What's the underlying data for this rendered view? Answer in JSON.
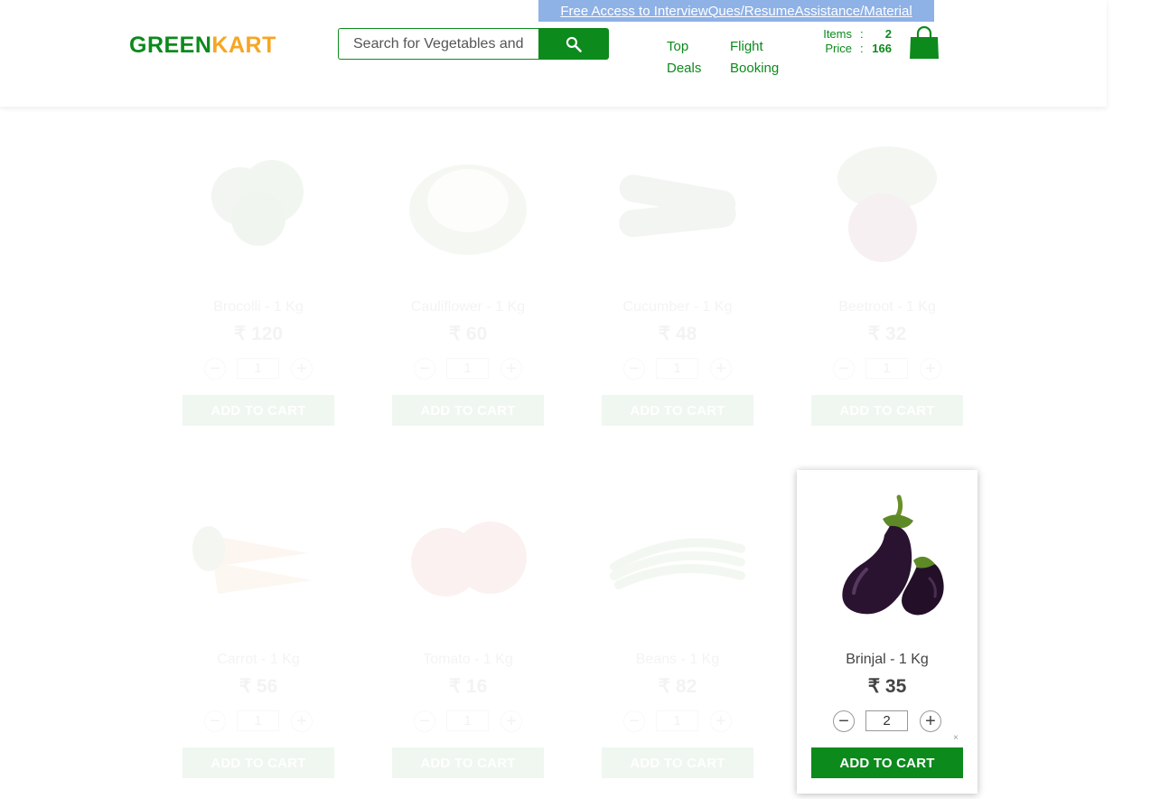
{
  "header": {
    "logo_green": "GREEN",
    "logo_kart": "KART",
    "search_placeholder": "Search for Vegetables and Fruits",
    "promo_link": "Free Access to InterviewQues/ResumeAssistance/Material",
    "nav": {
      "top_deals": "Top Deals",
      "flight_booking": "Flight Booking"
    },
    "cart": {
      "items_label": "Items",
      "items_value": "2",
      "price_label": "Price",
      "price_value": "166",
      "colon": ":"
    }
  },
  "products": [
    {
      "name": "Brocolli - 1 Kg",
      "price": "₹ 120",
      "qty": "1",
      "add_label": "ADD TO CART",
      "icon": "broccoli-image"
    },
    {
      "name": "Cauliflower - 1 Kg",
      "price": "₹ 60",
      "qty": "1",
      "add_label": "ADD TO CART",
      "icon": "cauliflower-image"
    },
    {
      "name": "Cucumber - 1 Kg",
      "price": "₹ 48",
      "qty": "1",
      "add_label": "ADD TO CART",
      "icon": "cucumber-image"
    },
    {
      "name": "Beetroot - 1 Kg",
      "price": "₹ 32",
      "qty": "1",
      "add_label": "ADD TO CART",
      "icon": "beetroot-image"
    },
    {
      "name": "Carrot - 1 Kg",
      "price": "₹ 56",
      "qty": "1",
      "add_label": "ADD TO CART",
      "icon": "carrot-image"
    },
    {
      "name": "Tomato - 1 Kg",
      "price": "₹ 16",
      "qty": "1",
      "add_label": "ADD TO CART",
      "icon": "tomato-image"
    },
    {
      "name": "Beans - 1 Kg",
      "price": "₹ 82",
      "qty": "1",
      "add_label": "ADD TO CART",
      "icon": "beans-image"
    },
    {
      "name": "Brinjal - 1 Kg",
      "price": "₹ 35",
      "qty": "2",
      "add_label": "ADD TO CART",
      "icon": "brinjal-image",
      "close": "×"
    }
  ],
  "colors": {
    "brand_green": "#0c8a1c",
    "brand_orange": "#f6a623",
    "promo_bg": "#8eb1e6"
  }
}
